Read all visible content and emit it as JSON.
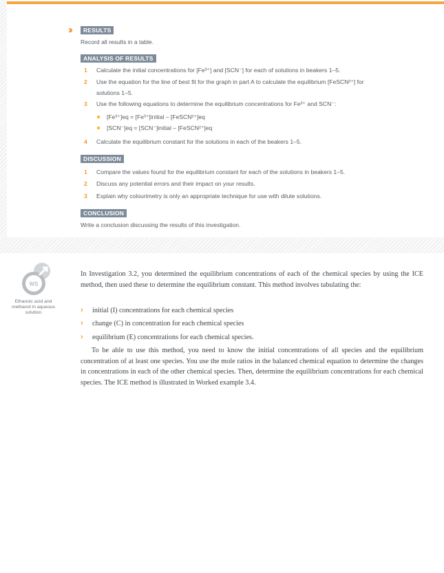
{
  "results": {
    "header": "RESULTS",
    "text": "Record all results in a table."
  },
  "analysis": {
    "header": "ANALYSIS OF RESULTS",
    "items": [
      {
        "num": "1",
        "text": "Calculate the initial concentrations for [Fe³⁺] and [SCN⁻] for each of solutions in beakers 1–5."
      },
      {
        "num": "2",
        "line1": "Use the equation for the line of best fit for the graph in part A to calculate the equilibrium [FeSCN²⁺] for",
        "line2": "solutions 1–5."
      },
      {
        "num": "3",
        "text": "Use the following equations to determine the equilibrium concentrations for Fe³⁺ and SCN⁻:"
      },
      {
        "num": "4",
        "text": "Calculate the equilibrium constant for the solutions in each of the beakers 1–5."
      }
    ],
    "equations": [
      "[Fe³⁺]eq = [Fe³⁺]initial – [FeSCN²⁺]eq",
      "[SCN⁻]eq = [SCN⁻]initial – [FeSCN²⁺]eq"
    ]
  },
  "discussion": {
    "header": "DISCUSSION",
    "items": [
      {
        "num": "1",
        "text": "Compare the values found for the equilibrium constant for each of the solutions in beakers 1–5."
      },
      {
        "num": "2",
        "text": "Discuss any potential errors and their impact on your results."
      },
      {
        "num": "3",
        "text": "Explain why colourimetry is only an appropriate technique for use with dilute solutions."
      }
    ]
  },
  "conclusion": {
    "header": "CONCLUSION",
    "text": "Write a conclusion discussing the results of this investigation."
  },
  "sidebar": {
    "icon_label": "WS",
    "caption": "Ethanoic acid and methanol in aqueous solution"
  },
  "main": {
    "intro": "In Investigation 3.2, you determined the equilibrium concentrations of each of the chemical species by using the ICE method, then used these to determine the equilibrium constant. This method involves tabulating the:",
    "bullets": [
      "initial (I) concentrations for each chemical species",
      "change (C) in concentration for each chemical species",
      "equilibrium (E) concentrations for each chemical species."
    ],
    "paragraph": "To be able to use this method, you need to know the initial concentrations of all species and the equilibrium concentration of at least one species. You use the mole ratios in the balanced chemical equation to determine the changes in concentrations in each of the other chemical species. Then, determine the equilibrium concentrations for each chemical species. The ICE method is illustrated in Worked example 3.4."
  },
  "colors": {
    "accent": "#f19b2c",
    "header_bg": "#7d8a99",
    "bullet": "#f4c03a"
  }
}
